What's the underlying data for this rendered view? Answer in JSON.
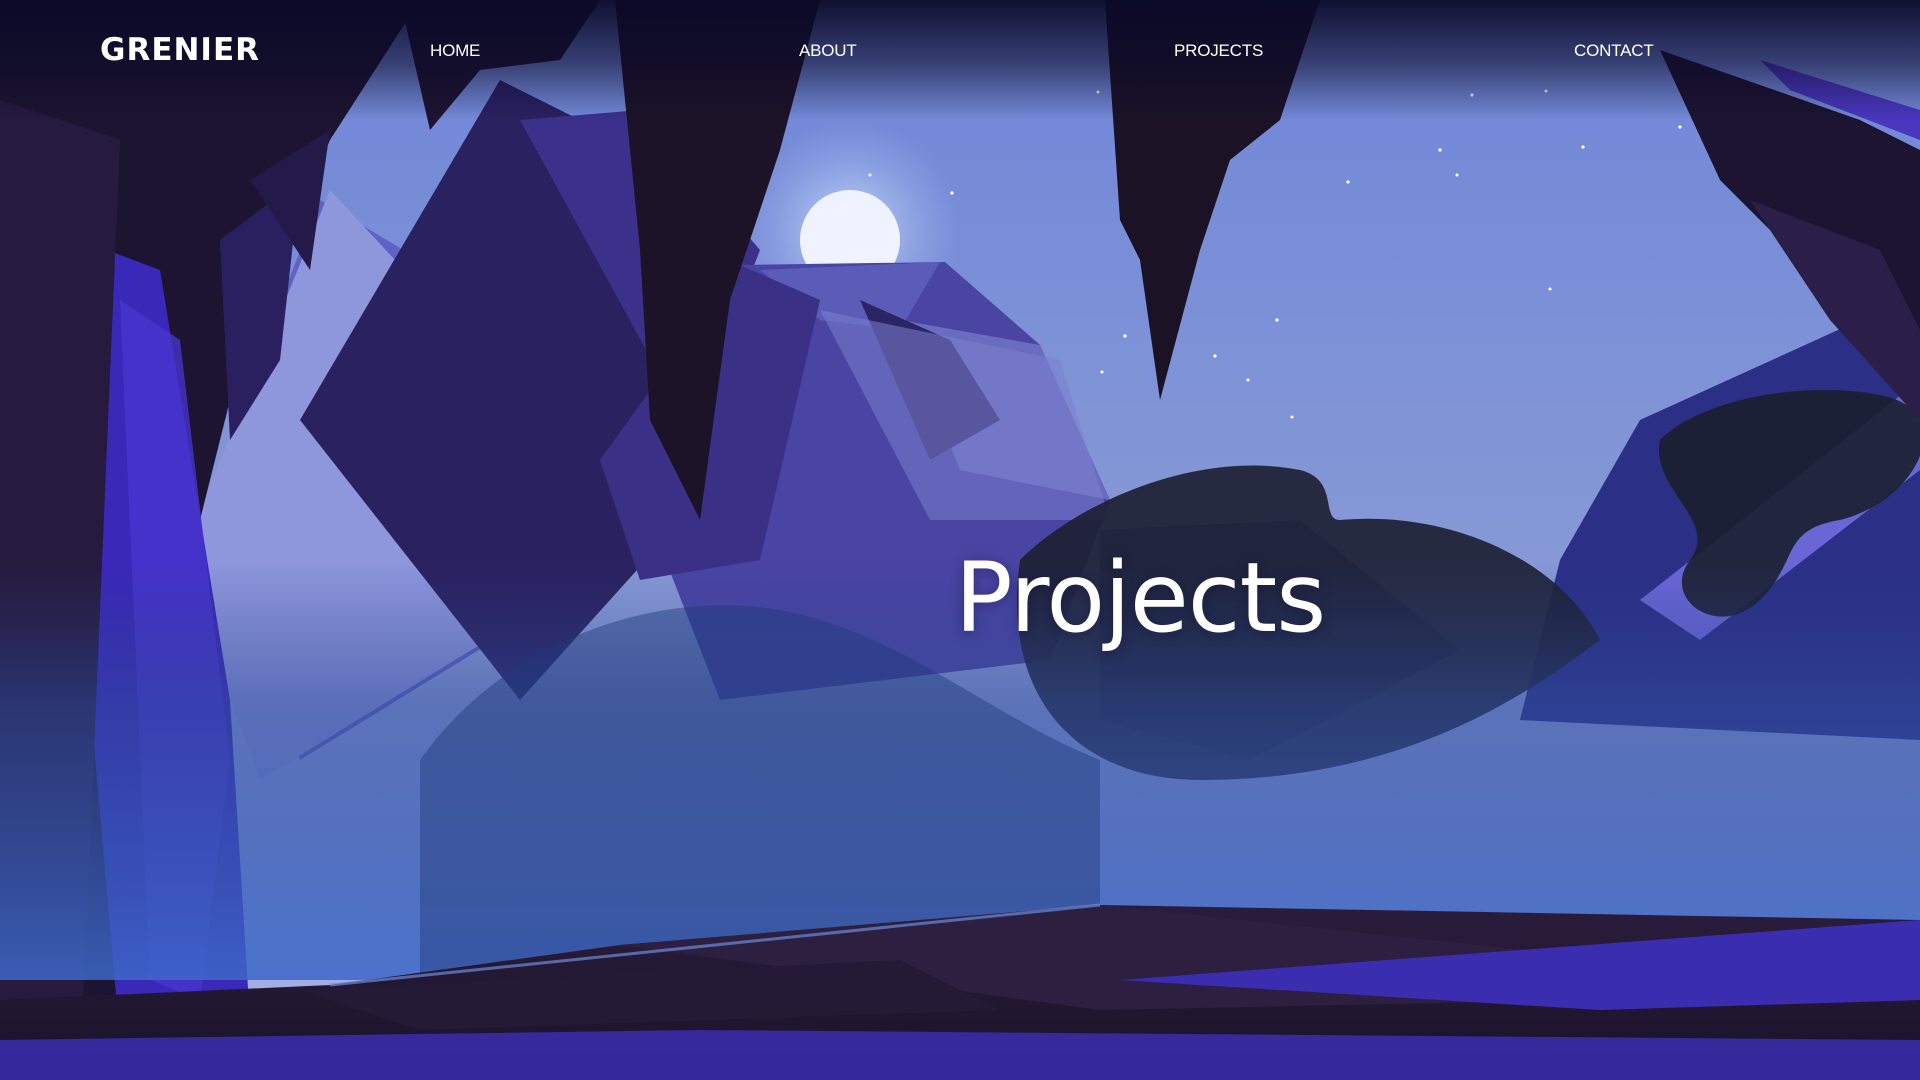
{
  "brand": {
    "name": "GRENIER"
  },
  "nav": {
    "items": [
      {
        "label": "HOME"
      },
      {
        "label": "ABOUT"
      },
      {
        "label": "PROJECTS"
      },
      {
        "label": "CONTACT"
      }
    ]
  },
  "hero": {
    "title": "Projects"
  },
  "colors": {
    "sky": "#7f93d6",
    "night": "#0b0a2a",
    "rock_dark": "#1e1530",
    "rock_purple": "#3b2fa0",
    "mist_blue": "#3a63c0",
    "text": "#ffffff"
  }
}
